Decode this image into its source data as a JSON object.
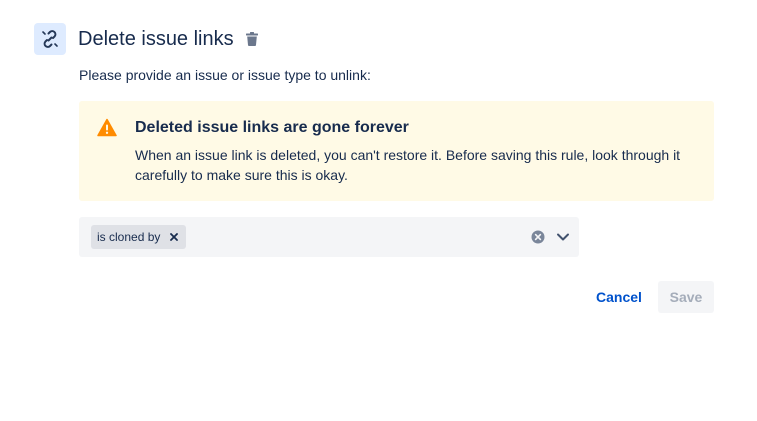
{
  "header": {
    "title": "Delete issue links",
    "icon": "unlink-icon",
    "trash_icon": "trash-icon",
    "accent_color": "#deebff"
  },
  "form": {
    "prompt": "Please provide an issue or issue type to unlink:"
  },
  "warning": {
    "icon": "warning-icon",
    "title": "Deleted issue links are gone forever",
    "body": "When an issue link is deleted, you can't restore it. Before saving this rule, look through it carefully to make sure this is okay.",
    "background_color": "#fffae6",
    "icon_color": "#ff8b00"
  },
  "select": {
    "selected": [
      {
        "label": "is cloned by"
      }
    ],
    "clear_icon": "clear-icon",
    "dropdown_icon": "chevron-down-icon"
  },
  "actions": {
    "cancel_label": "Cancel",
    "save_label": "Save",
    "link_color": "#0052cc"
  }
}
